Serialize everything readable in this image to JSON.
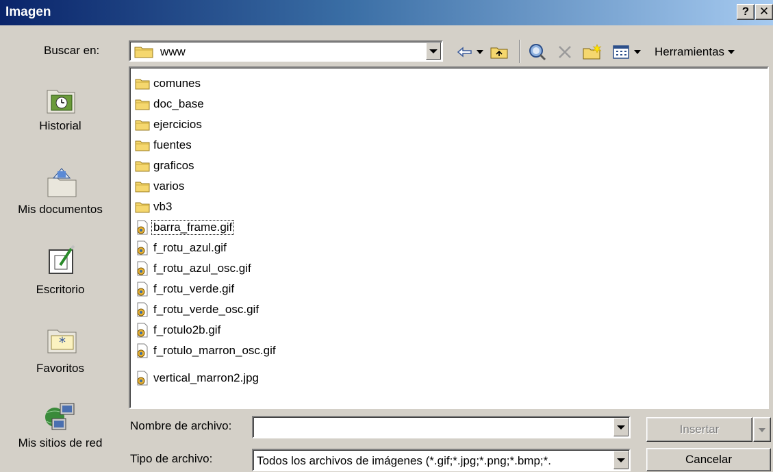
{
  "window": {
    "title": "Imagen",
    "help_label": "?",
    "close_label": "✕"
  },
  "lookin": {
    "label": "Buscar en:",
    "value": "www"
  },
  "toolbar": {
    "tools_label": "Herramientas"
  },
  "places": [
    {
      "label": "Historial",
      "icon": "history-icon"
    },
    {
      "label": "Mis documentos",
      "icon": "my-documents-icon"
    },
    {
      "label": "Escritorio",
      "icon": "desktop-icon"
    },
    {
      "label": "Favoritos",
      "icon": "favorites-icon"
    },
    {
      "label": "Mis sitios de red",
      "icon": "network-places-icon"
    }
  ],
  "files": [
    {
      "name": "comunes",
      "type": "folder"
    },
    {
      "name": "doc_base",
      "type": "folder"
    },
    {
      "name": "ejercicios",
      "type": "folder"
    },
    {
      "name": "fuentes",
      "type": "folder"
    },
    {
      "name": "graficos",
      "type": "folder"
    },
    {
      "name": "varios",
      "type": "folder"
    },
    {
      "name": "vb3",
      "type": "folder"
    },
    {
      "name": "barra_frame.gif",
      "type": "image",
      "focused": true
    },
    {
      "name": "f_rotu_azul.gif",
      "type": "image"
    },
    {
      "name": "f_rotu_azul_osc.gif",
      "type": "image"
    },
    {
      "name": "f_rotu_verde.gif",
      "type": "image"
    },
    {
      "name": "f_rotu_verde_osc.gif",
      "type": "image"
    },
    {
      "name": "f_rotulo2b.gif",
      "type": "image"
    },
    {
      "name": "f_rotulo_marron_osc.gif",
      "type": "image"
    },
    {
      "name": "vertical_marron2.jpg",
      "type": "image"
    }
  ],
  "filename": {
    "label": "Nombre de archivo:",
    "value": ""
  },
  "filetype": {
    "label": "Tipo de archivo:",
    "value": "Todos los archivos de imágenes (*.gif;*.jpg;*.png;*.bmp;*."
  },
  "buttons": {
    "insert": "Insertar",
    "cancel": "Cancelar"
  },
  "colors": {
    "titlebar_start": "#0a246a",
    "titlebar_end": "#a6caf0",
    "dialog_face": "#d4d0c8",
    "folder_yellow": "#f5d76e"
  }
}
